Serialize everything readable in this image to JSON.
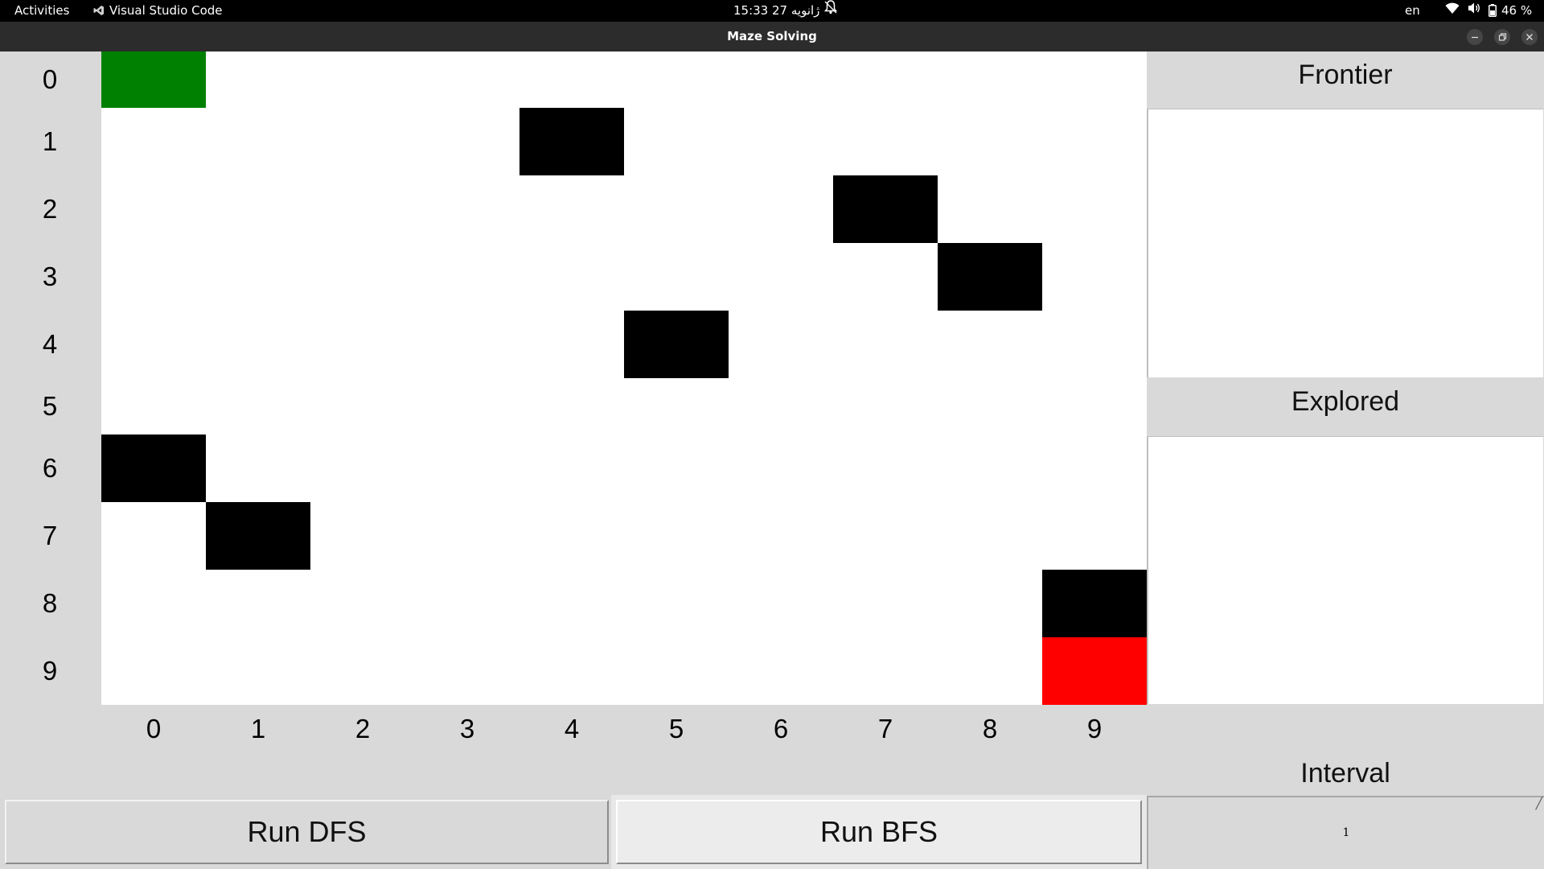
{
  "topbar": {
    "activities": "Activities",
    "app_name": "Visual Studio Code",
    "clock": "15:33  27 ژانویه",
    "language": "en",
    "battery": "46 %"
  },
  "window": {
    "title": "Maze Solving"
  },
  "maze": {
    "rows": 10,
    "cols": 10,
    "row_labels": [
      "0",
      "1",
      "2",
      "3",
      "4",
      "5",
      "6",
      "7",
      "8",
      "9"
    ],
    "col_labels": [
      "0",
      "1",
      "2",
      "3",
      "4",
      "5",
      "6",
      "7",
      "8",
      "9"
    ],
    "start": [
      0,
      0
    ],
    "goal": [
      9,
      9
    ],
    "walls": [
      [
        1,
        4
      ],
      [
        2,
        7
      ],
      [
        3,
        8
      ],
      [
        4,
        5
      ],
      [
        6,
        0
      ],
      [
        7,
        1
      ],
      [
        8,
        9
      ]
    ],
    "colors": {
      "wall": "#000000",
      "start": "#008000",
      "goal": "#ff0000",
      "empty": "#ffffff"
    }
  },
  "panel": {
    "frontier_title": "Frontier",
    "frontier_items": [],
    "explored_title": "Explored",
    "explored_items": [],
    "interval_title": "Interval",
    "interval_value": "1"
  },
  "buttons": {
    "run_dfs": "Run DFS",
    "run_bfs": "Run BFS"
  }
}
